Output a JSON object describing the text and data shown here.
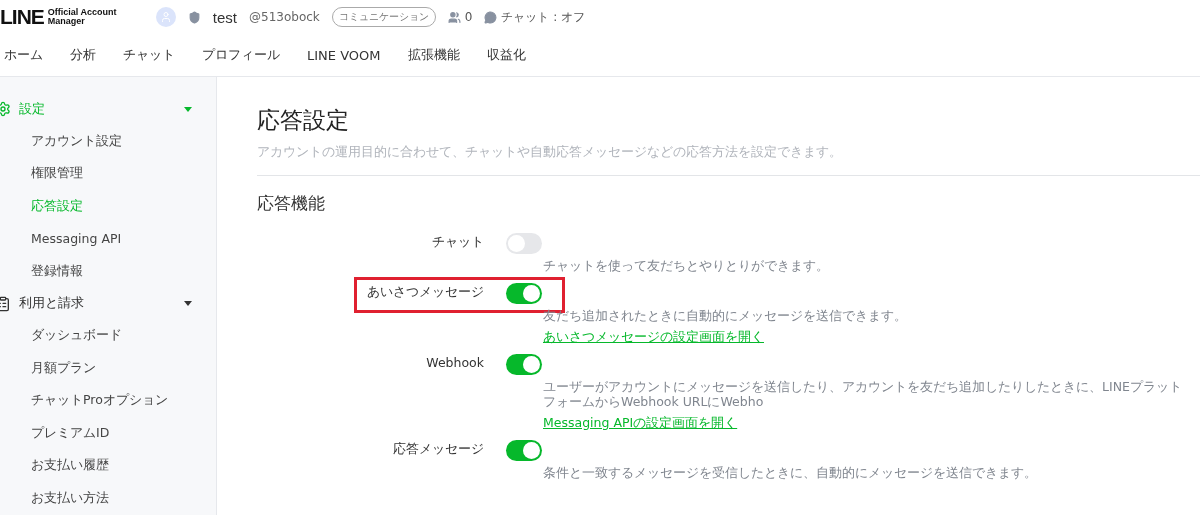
{
  "header": {
    "logo_main": "LINE",
    "logo_sub": "Official Account Manager",
    "account_name": "test",
    "account_id": "@513obock",
    "badge": "コミュニケーション",
    "friends_count": "0",
    "chat_status": "チャット : オフ"
  },
  "nav": [
    {
      "label": "ホーム"
    },
    {
      "label": "分析"
    },
    {
      "label": "チャット"
    },
    {
      "label": "プロフィール"
    },
    {
      "label": "LINE VOOM"
    },
    {
      "label": "拡張機能"
    },
    {
      "label": "収益化"
    }
  ],
  "sidebar": [
    {
      "label": "設定",
      "kind": "settings",
      "selected": true,
      "expanded": true,
      "children": [
        {
          "label": "アカウント設定",
          "selected": false
        },
        {
          "label": "権限管理",
          "selected": false
        },
        {
          "label": "応答設定",
          "selected": true
        },
        {
          "label": "Messaging API",
          "selected": false
        },
        {
          "label": "登録情報",
          "selected": false
        }
      ]
    },
    {
      "label": "利用と請求",
      "kind": "billing",
      "selected": false,
      "expanded": true,
      "children": [
        {
          "label": "ダッシュボード",
          "selected": false
        },
        {
          "label": "月額プラン",
          "selected": false
        },
        {
          "label": "チャットProオプション",
          "selected": false
        },
        {
          "label": "プレミアムID",
          "selected": false
        },
        {
          "label": "お支払い履歴",
          "selected": false
        },
        {
          "label": "お支払い方法",
          "selected": false
        }
      ]
    }
  ],
  "page": {
    "title": "応答設定",
    "description": "アカウントの運用目的に合わせて、チャットや自動応答メッセージなどの応答方法を設定できます。",
    "section_title": "応答機能"
  },
  "settings": [
    {
      "label": "チャット",
      "on": false,
      "highlighted": false,
      "description": "チャットを使って友だちとやりとりができます。"
    },
    {
      "label": "あいさつメッセージ",
      "on": true,
      "highlighted": true,
      "description": "友だち追加されたときに自動的にメッセージを送信できます。",
      "link": "あいさつメッセージの設定画面を開く"
    },
    {
      "label": "Webhook",
      "on": true,
      "highlighted": false,
      "description": "ユーザーがアカウントにメッセージを送信したり、アカウントを友だち追加したりしたときに、LINEプラットフォームからWebhook URLにWebho",
      "link": "Messaging APIの設定画面を開く"
    },
    {
      "label": "応答メッセージ",
      "on": true,
      "highlighted": false,
      "description": "条件と一致するメッセージを受信したときに、自動的にメッセージを送信できます。"
    }
  ]
}
